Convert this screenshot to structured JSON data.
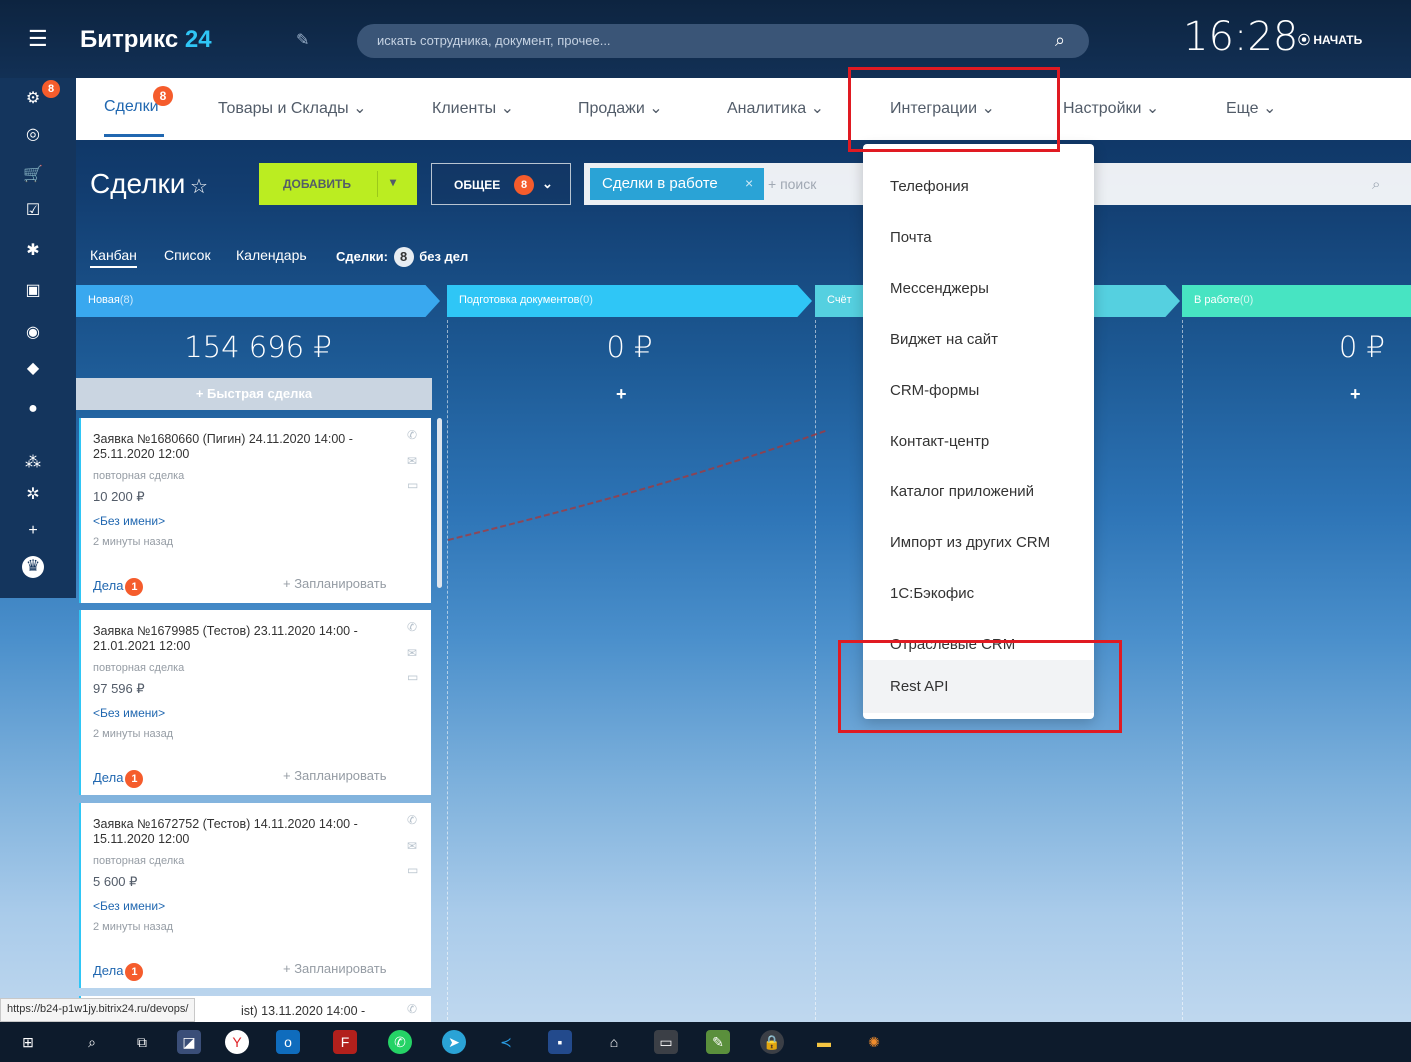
{
  "topbar": {
    "logo_text": "Битрикс",
    "logo_num": "24",
    "search_placeholder": "искать сотрудника, документ, прочее...",
    "clock": "16:28",
    "start_label": "НАЧАТЬ"
  },
  "sidebar": {
    "badge": "8"
  },
  "nav": {
    "items": [
      "Сделки",
      "Товары и Склады ⌄",
      "Клиенты ⌄",
      "Продажи ⌄",
      "Аналитика ⌄",
      "Интеграции ⌄",
      "Настройки ⌄",
      "Еще ⌄"
    ],
    "badge": "8"
  },
  "toolbar": {
    "title": "Сделки",
    "add_label": "ДОБАВИТЬ",
    "common_label": "ОБЩЕЕ",
    "common_count": "8",
    "filter_tag": "Сделки в работе",
    "filter_placeholder": "+ поиск"
  },
  "views": {
    "kanban": "Канбан",
    "list": "Список",
    "calendar": "Календарь",
    "deals_label": "Сделки:",
    "deals_count": "8",
    "deals_suffix": "без дел"
  },
  "columns": [
    {
      "name": "Новая",
      "count": "(8)",
      "sum": "154 696 ₽",
      "color": "#39a8ef"
    },
    {
      "name": "Подготовка документов",
      "count": "(0)",
      "sum": "0 ₽",
      "color": "#2fc6f6"
    },
    {
      "name": "Счёт",
      "count": "",
      "sum": "",
      "color": "#55d0e0"
    },
    {
      "name": "",
      "count": "",
      "sum": "",
      "color": "#47d1e2"
    },
    {
      "name": "В работе",
      "count": "(0)",
      "sum": "0 ₽",
      "color": "#47e4c2"
    }
  ],
  "quick_deal": "+ Быстрая сделка",
  "cards": [
    {
      "title": "Заявка №1680660 (Пигин) 24.11.2020 14:00 - 25.11.2020 12:00",
      "sub": "повторная сделка",
      "sum": "10 200 ₽",
      "client": "<Без имени>",
      "time": "2 минуты назад",
      "deals": "Дела",
      "deals_count": "1",
      "plan": "+ Запланировать"
    },
    {
      "title": "Заявка №1679985 (Тестов) 23.11.2020 14:00 - 21.01.2021 12:00",
      "sub": "повторная сделка",
      "sum": "97 596 ₽",
      "client": "<Без имени>",
      "time": "2 минуты назад",
      "deals": "Дела",
      "deals_count": "1",
      "plan": "+ Запланировать"
    },
    {
      "title": "Заявка №1672752 (Тестов) 14.11.2020 14:00 - 15.11.2020 12:00",
      "sub": "повторная сделка",
      "sum": "5 600 ₽",
      "client": "<Без имени>",
      "time": "2 минуты назад",
      "deals": "Дела",
      "deals_count": "1",
      "plan": "+ Запланировать"
    },
    {
      "title": "ist) 13.11.2020 14:00 -",
      "sub": "",
      "sum": "",
      "client": "",
      "time": "",
      "deals": "",
      "deals_count": "",
      "plan": ""
    }
  ],
  "menu": {
    "items": [
      "Телефония",
      "Почта",
      "Мессенджеры",
      "Виджет на сайт",
      "CRM-формы",
      "Контакт-центр",
      "Каталог приложений",
      "Импорт из других CRM",
      "1С:Бэкофис",
      "Отраслевые CRM",
      "Rest API"
    ],
    "selected": "Rest API"
  },
  "status_url": "https://b24-p1w1jy.bitrix24.ru/devops/",
  "taskbar": {
    "icons": [
      "windows-icon",
      "search-icon",
      "task-view-icon",
      "app-icon",
      "yandex-browser-icon",
      "outlook-icon",
      "filezilla-icon",
      "whatsapp-icon",
      "telegram-icon",
      "vscode-icon",
      "save-app-icon",
      "network-app-icon",
      "terminal-icon",
      "editor-icon",
      "vpn-icon",
      "explorer-icon",
      "settings-app-icon"
    ]
  },
  "colors": {
    "accent": "#2067b0",
    "badge": "#f55c2c",
    "add_button": "#bbed21",
    "highlight": "#e01a22"
  }
}
